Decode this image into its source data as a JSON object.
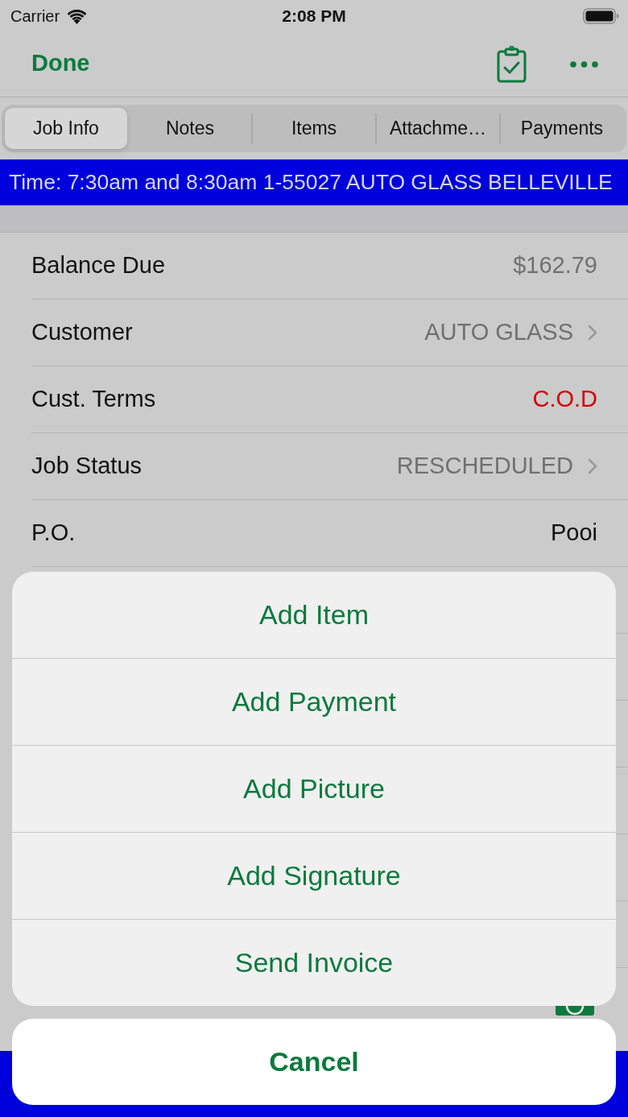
{
  "status_bar": {
    "carrier": "Carrier",
    "time": "2:08 PM"
  },
  "nav_bar": {
    "done": "Done"
  },
  "tabs": [
    {
      "label": "Job Info",
      "selected": true
    },
    {
      "label": "Notes",
      "selected": false
    },
    {
      "label": "Items",
      "selected": false
    },
    {
      "label": "Attachme…",
      "selected": false
    },
    {
      "label": "Payments",
      "selected": false
    }
  ],
  "banner": {
    "text": "Time: 7:30am and 8:30am 1-55027 AUTO GLASS BELLEVILLE"
  },
  "fields": [
    {
      "label": "Balance Due",
      "value": "$162.79",
      "kind": "amount"
    },
    {
      "label": "Customer",
      "value": "AUTO GLASS",
      "kind": "disclosure"
    },
    {
      "label": "Cust. Terms",
      "value": "C.O.D",
      "kind": "alert"
    },
    {
      "label": "Job Status",
      "value": "RESCHEDULED",
      "kind": "disclosure"
    },
    {
      "label": "P.O.",
      "value": "Pooi",
      "kind": "text"
    }
  ],
  "action_sheet": {
    "actions": [
      "Add Item",
      "Add Payment",
      "Add Picture",
      "Add Signature",
      "Send Invoice"
    ],
    "cancel": "Cancel"
  }
}
